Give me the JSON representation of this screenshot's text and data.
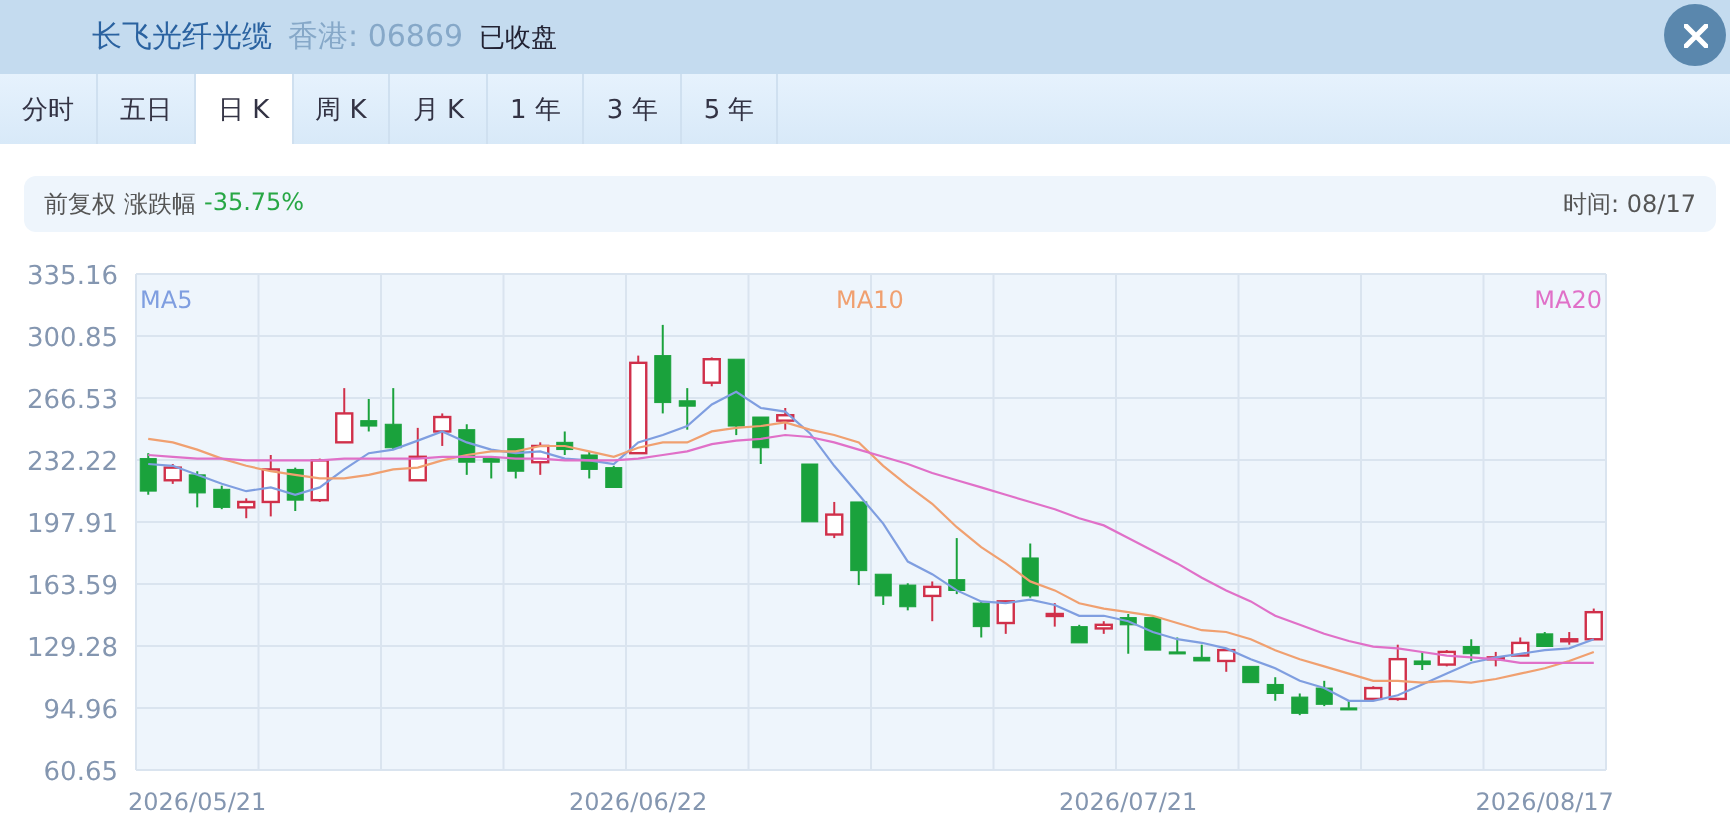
{
  "header": {
    "title": "长飞光纤光缆",
    "market_code": "香港: 06869",
    "status": "已收盘"
  },
  "tabs": [
    {
      "label": "分时",
      "selected": false
    },
    {
      "label": "五日",
      "selected": false
    },
    {
      "label": "日 K",
      "selected": true
    },
    {
      "label": "周 K",
      "selected": false
    },
    {
      "label": "月 K",
      "selected": false
    },
    {
      "label": "1 年",
      "selected": false
    },
    {
      "label": "3 年",
      "selected": false
    },
    {
      "label": "5 年",
      "selected": false
    }
  ],
  "info_bar": {
    "adjustment": "前复权",
    "change_label": "涨跌幅",
    "change_value": "-35.75%",
    "time": "时间: 08/17"
  },
  "chart": {
    "chart_data": {
      "type": "candlestick",
      "grid": true,
      "ylim": [
        60.65,
        335.16
      ],
      "yticks": [
        335.16,
        300.85,
        266.53,
        232.22,
        197.91,
        163.59,
        129.28,
        94.96,
        60.65
      ],
      "categories": [
        null,
        null,
        "2026/05/21",
        null,
        null,
        null,
        null,
        null,
        null,
        null,
        null,
        null,
        null,
        null,
        null,
        null,
        null,
        null,
        null,
        null,
        "2026/06/22",
        null,
        null,
        null,
        null,
        null,
        null,
        null,
        null,
        null,
        null,
        null,
        null,
        null,
        null,
        null,
        null,
        null,
        null,
        null,
        "2026/07/21",
        null,
        null,
        null,
        null,
        null,
        null,
        null,
        null,
        null,
        null,
        null,
        null,
        null,
        null,
        null,
        null,
        "2026/08/17",
        null,
        null
      ],
      "ohlc": [
        [
          233,
          236,
          213,
          215
        ],
        [
          221,
          230,
          219,
          228
        ],
        [
          224,
          226,
          206,
          214
        ],
        [
          216,
          218,
          205,
          206
        ],
        [
          206,
          211,
          200,
          209
        ],
        [
          209,
          235,
          201,
          227
        ],
        [
          227,
          228,
          204,
          210
        ],
        [
          210,
          233,
          209,
          232
        ],
        [
          242,
          272,
          242,
          258
        ],
        [
          254,
          266,
          248,
          251
        ],
        [
          252,
          272,
          238,
          239
        ],
        [
          221,
          250,
          221,
          234
        ],
        [
          248,
          258,
          240,
          256
        ],
        [
          249,
          252,
          224,
          231
        ],
        [
          233,
          233,
          222,
          231
        ],
        [
          244,
          244,
          222,
          226
        ],
        [
          231,
          242,
          224,
          240
        ],
        [
          242,
          248,
          235,
          238
        ],
        [
          235,
          237,
          222,
          227
        ],
        [
          228,
          229,
          217,
          217
        ],
        [
          236,
          290,
          236,
          286
        ],
        [
          290,
          307,
          258,
          264
        ],
        [
          265,
          272,
          249,
          262
        ],
        [
          275,
          289,
          273,
          288
        ],
        [
          288,
          288,
          246,
          251
        ],
        [
          256,
          256,
          230,
          239
        ],
        [
          254,
          261,
          249,
          257
        ],
        [
          230,
          230,
          198,
          198
        ],
        [
          191,
          209,
          189,
          202
        ],
        [
          209,
          209,
          163,
          171
        ],
        [
          169,
          169,
          152,
          157
        ],
        [
          163,
          164,
          149,
          151
        ],
        [
          157,
          165,
          143,
          162
        ],
        [
          166,
          189,
          158,
          160
        ],
        [
          153,
          154,
          134,
          140
        ],
        [
          142,
          154,
          136,
          154
        ],
        [
          178,
          186,
          156,
          157
        ],
        [
          146,
          153,
          140,
          147
        ],
        [
          140,
          141,
          131,
          131
        ],
        [
          139,
          143,
          136,
          141
        ],
        [
          145,
          147,
          125,
          141
        ],
        [
          145,
          145,
          127,
          127
        ],
        [
          126,
          134,
          125,
          125
        ],
        [
          123,
          130,
          121,
          121
        ],
        [
          121,
          127,
          115,
          127
        ],
        [
          118,
          118,
          109,
          109
        ],
        [
          108,
          112,
          99,
          103
        ],
        [
          101,
          103,
          91,
          92
        ],
        [
          106,
          110,
          96,
          97
        ],
        [
          95,
          99,
          94,
          94
        ],
        [
          100,
          107,
          100,
          106
        ],
        [
          100,
          130,
          99,
          122
        ],
        [
          121,
          126,
          116,
          119
        ],
        [
          119,
          127,
          118,
          126
        ],
        [
          129,
          133,
          121,
          125
        ],
        [
          122,
          126,
          118,
          123
        ],
        [
          124,
          134,
          124,
          131
        ],
        [
          136,
          137,
          129,
          129
        ],
        [
          132,
          137,
          130,
          133
        ],
        [
          133,
          150,
          133,
          148
        ]
      ],
      "series": [
        {
          "name": "MA5",
          "type": "line",
          "color": "#7f9ee0",
          "values": [
            230,
            229,
            224,
            219,
            215,
            217,
            213,
            217,
            227,
            236,
            238,
            243,
            248,
            242,
            238,
            236,
            237,
            233,
            232,
            230,
            242,
            246,
            251,
            263,
            270,
            261,
            259,
            247,
            229,
            213,
            197,
            176,
            169,
            160,
            154,
            153,
            155,
            152,
            146,
            146,
            143,
            137,
            133,
            131,
            128,
            122,
            117,
            110,
            106,
            99,
            99,
            102,
            108,
            114,
            120,
            123,
            125,
            127,
            128,
            133
          ]
        },
        {
          "name": "MA10",
          "type": "line",
          "color": "#f0a070",
          "values": [
            244,
            242,
            238,
            233,
            229,
            226,
            224,
            222,
            222,
            224,
            227,
            228,
            232,
            235,
            237,
            237,
            240,
            240,
            237,
            234,
            239,
            242,
            242,
            248,
            250,
            251,
            253,
            249,
            246,
            242,
            229,
            218,
            208,
            195,
            184,
            175,
            165,
            160,
            153,
            150,
            148,
            146,
            142,
            138,
            137,
            133,
            127,
            122,
            118,
            114,
            110,
            110,
            109,
            110,
            109,
            111,
            114,
            117,
            121,
            126
          ]
        },
        {
          "name": "MA20",
          "type": "line",
          "color": "#e070c8",
          "values": [
            235,
            234,
            233,
            233,
            232,
            232,
            232,
            232,
            233,
            233,
            233,
            233,
            234,
            234,
            234,
            233,
            233,
            232,
            232,
            232,
            233,
            235,
            237,
            241,
            243,
            244,
            246,
            245,
            242,
            238,
            234,
            230,
            225,
            221,
            217,
            213,
            209,
            205,
            200,
            196,
            189,
            182,
            175,
            167,
            160,
            154,
            146,
            141,
            136,
            132,
            129,
            128,
            126,
            124,
            123,
            122,
            120,
            120,
            120,
            120
          ]
        }
      ]
    }
  }
}
